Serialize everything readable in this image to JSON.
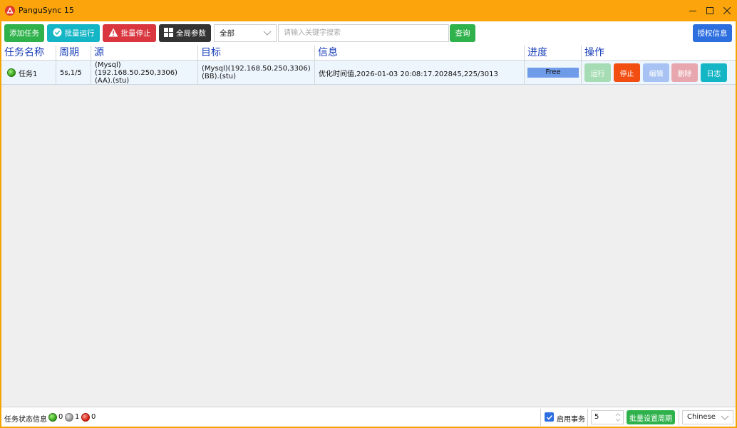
{
  "window": {
    "title": "PanguSync 15"
  },
  "toolbar": {
    "add_task": "添加任务",
    "batch_run": "批量运行",
    "batch_stop": "批量停止",
    "global_params": "全局参数",
    "filter_selected": "全部",
    "search_placeholder": "请输入关键字搜索",
    "query": "查询",
    "license_info": "授权信息"
  },
  "table": {
    "headers": {
      "name": "任务名称",
      "period": "周期",
      "source": "源",
      "target": "目标",
      "info": "信息",
      "progress": "进度",
      "actions": "操作"
    },
    "rows": [
      {
        "name": "任务1",
        "status": "green",
        "period": "5s,1/5",
        "source_line1": "(Mysql)(192.168.50.250,3306)",
        "source_line2": "(AA).(stu)",
        "target_line1": "(Mysql)(192.168.50.250,3306)",
        "target_line2": "(BB).(stu)",
        "info": "优化时间值,2026-01-03 20:08:17.202845,225/3013",
        "progress_label": "Free",
        "progress_fraction": 1.0,
        "actions": {
          "run": "运行",
          "stop": "停止",
          "edit": "编辑",
          "delete": "删除",
          "log": "日志"
        }
      }
    ]
  },
  "statusbar": {
    "label": "任务状态信息",
    "green_count": "0",
    "gray_count": "1",
    "red_count": "0",
    "enable_transaction": "启用事务",
    "transaction_checked": true,
    "period_value": "5",
    "batch_set_period": "批量设置周期",
    "language": "Chinese"
  },
  "colors": {
    "window_frame": "#f4a400",
    "header_text": "#1a3fb8",
    "green": "#2fb24c",
    "teal": "#14b5c5",
    "red": "#d9363f",
    "dark": "#333333",
    "blue": "#2e6fe0",
    "stop_orange": "#f24e12"
  }
}
